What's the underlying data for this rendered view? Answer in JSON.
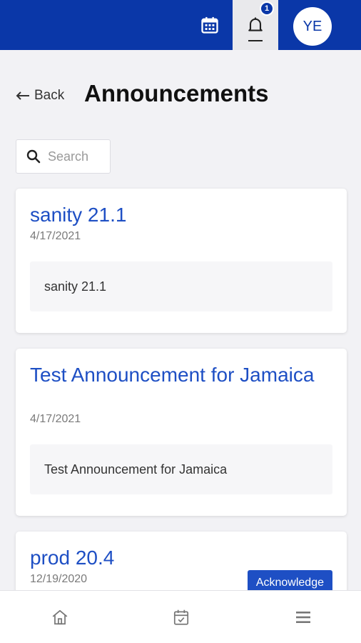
{
  "header": {
    "notification_count": "1",
    "avatar_initials": "YE",
    "brand_color": "#0a37a8"
  },
  "page": {
    "back_label": "Back",
    "title": "Announcements"
  },
  "search": {
    "placeholder": "Search",
    "value": ""
  },
  "announcements": [
    {
      "title": "sanity 21.1",
      "date": "4/17/2021",
      "body": "sanity 21.1"
    },
    {
      "title": "Test Announcement for Jamaica",
      "date": "4/17/2021",
      "body": "Test Announcement for Jamaica"
    },
    {
      "title": "prod 20.4",
      "date": "12/19/2020",
      "action_label": "Acknowledge"
    }
  ],
  "bottom_nav": {
    "items": [
      {
        "icon": "home-icon"
      },
      {
        "icon": "calendar-check-icon"
      },
      {
        "icon": "hamburger-menu-icon"
      }
    ]
  }
}
